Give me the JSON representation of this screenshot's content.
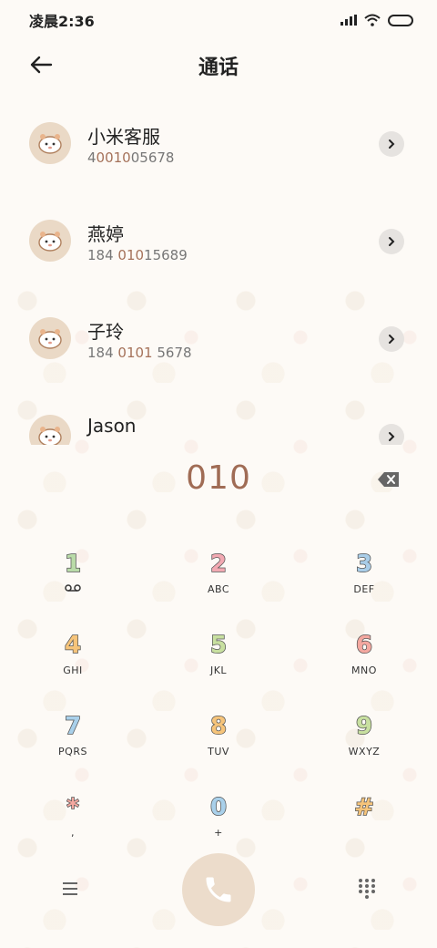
{
  "status_bar": {
    "time": "凌晨2:36"
  },
  "header": {
    "title": "通话"
  },
  "contacts": [
    {
      "name": "小米客服",
      "number_parts": [
        "4",
        "0010",
        "05678"
      ],
      "highlight_index": 1
    },
    {
      "name": "燕婷",
      "number_parts": [
        "184 ",
        "010",
        "15689"
      ],
      "highlight_index": 1
    },
    {
      "name": "子玲",
      "number_parts": [
        "184 ",
        "0101",
        " 5678"
      ],
      "highlight_index": 1
    },
    {
      "name": "Jason",
      "number_parts": [
        "",
        "",
        ""
      ],
      "highlight_index": 1
    }
  ],
  "dialer": {
    "typed": "010",
    "keys": [
      {
        "digit": "1",
        "sub": "",
        "color": "#b9dba8",
        "icon": "voicemail-icon"
      },
      {
        "digit": "2",
        "sub": "ABC",
        "color": "#f2a9b2"
      },
      {
        "digit": "3",
        "sub": "DEF",
        "color": "#a9cde8"
      },
      {
        "digit": "4",
        "sub": "GHI",
        "color": "#f6c47a"
      },
      {
        "digit": "5",
        "sub": "JKL",
        "color": "#c8e0a0"
      },
      {
        "digit": "6",
        "sub": "MNO",
        "color": "#f4a8a0"
      },
      {
        "digit": "7",
        "sub": "PQRS",
        "color": "#a9d0ea"
      },
      {
        "digit": "8",
        "sub": "TUV",
        "color": "#f6c47a"
      },
      {
        "digit": "9",
        "sub": "WXYZ",
        "color": "#c8e0a0"
      },
      {
        "digit": "*",
        "sub": ",",
        "color": "#f4a8a0"
      },
      {
        "digit": "0",
        "sub": "+",
        "color": "#a9d0ea"
      },
      {
        "digit": "#",
        "sub": "",
        "color": "#f6c47a"
      }
    ]
  },
  "colors": {
    "accent": "#a06c55",
    "call_button": "#ecdccb",
    "avatar_bg": "#ead9c6"
  },
  "icons": [
    "back-arrow-icon",
    "chevron-right-icon",
    "backspace-icon",
    "phone-icon",
    "menu-icon",
    "dialpad-icon",
    "wifi-icon",
    "signal-icon",
    "battery-icon"
  ]
}
